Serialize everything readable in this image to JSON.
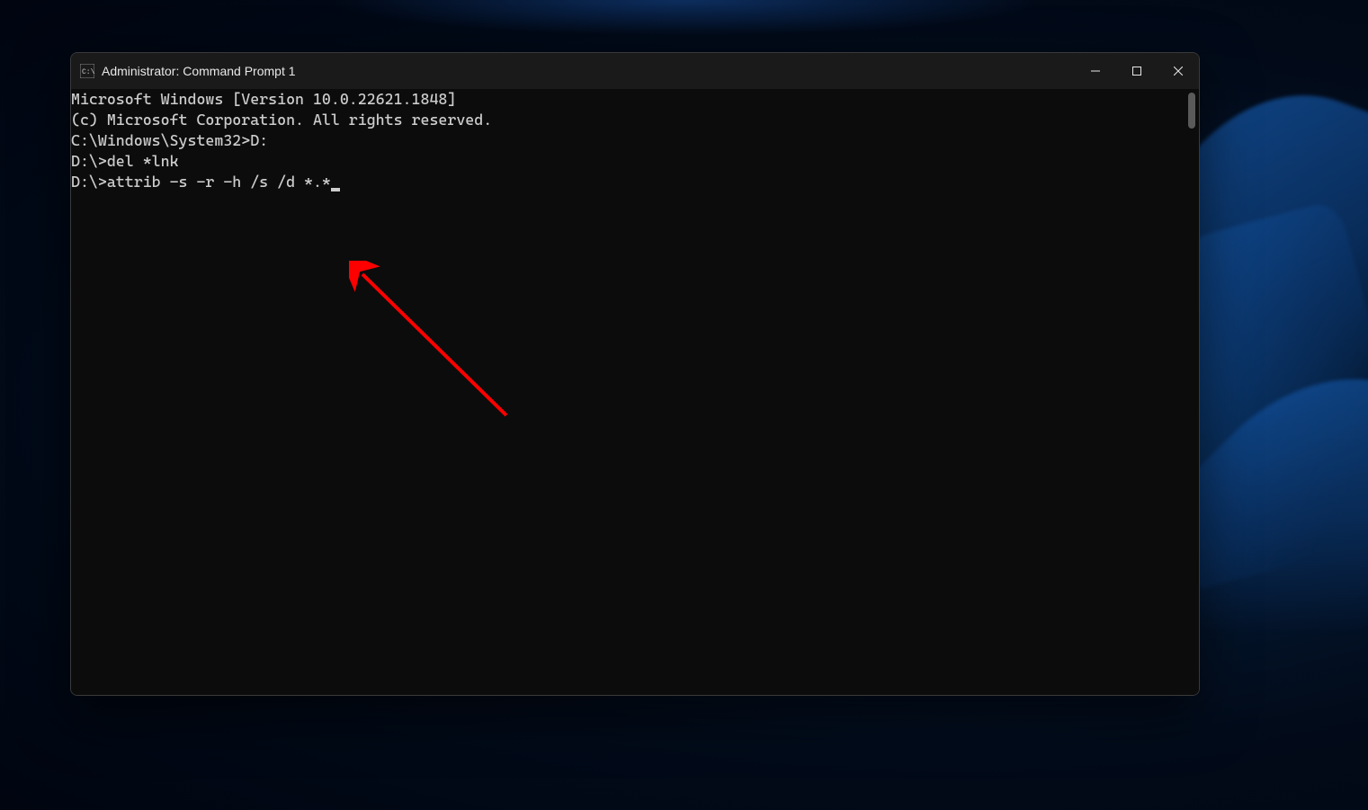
{
  "window": {
    "title": "Administrator: Command Prompt 1"
  },
  "terminal": {
    "lines": {
      "l0": "Microsoft Windows [Version 10.0.22621.1848]",
      "l1": "(c) Microsoft Corporation. All rights reserved.",
      "l2": "",
      "l3": "C:\\Windows\\System32>D:",
      "l4": "",
      "l5": "D:\\>del *lnk",
      "l6": "",
      "l7_prompt": "D:\\>",
      "l7_command": "attrib -s -r -h /s /d *.*"
    }
  },
  "annotation": {
    "arrow_color": "#ff0000"
  }
}
